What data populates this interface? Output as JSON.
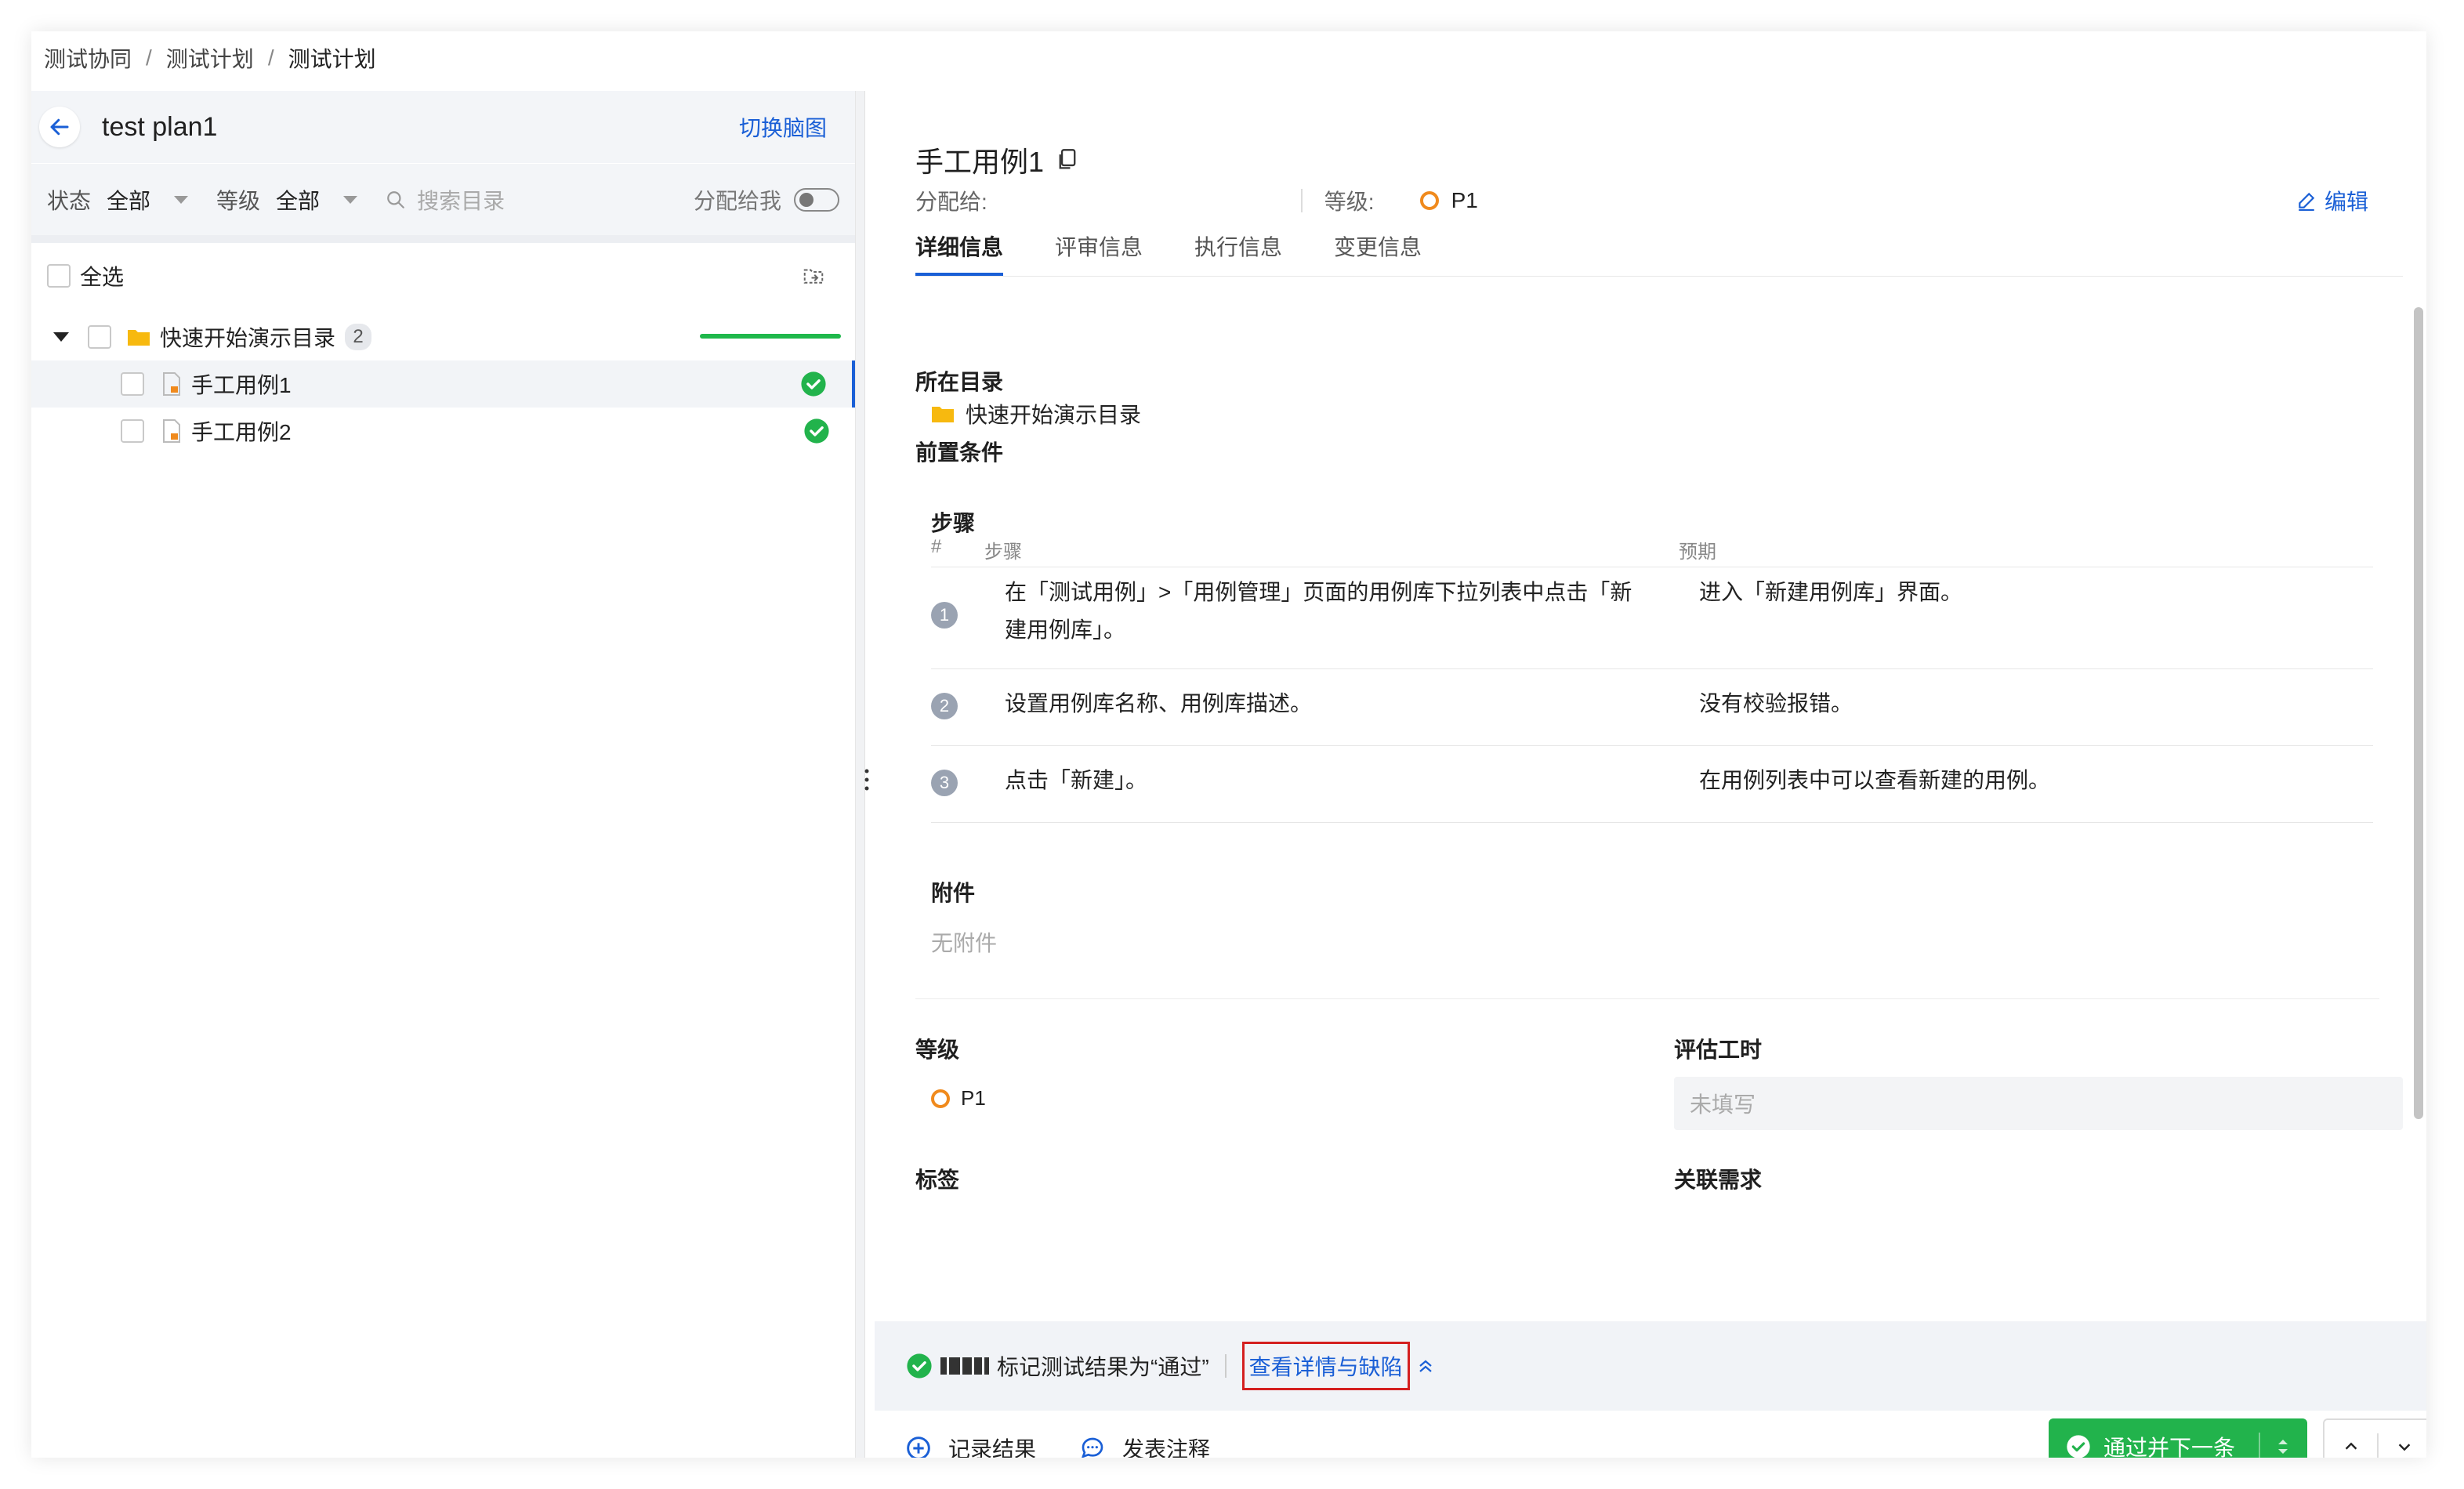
{
  "breadcrumb": [
    "测试协同",
    "测试计划",
    "测试计划"
  ],
  "left": {
    "plan_title": "test plan1",
    "switch_link": "切换脑图",
    "filters": {
      "status_label": "状态",
      "status_value": "全部",
      "level_label": "等级",
      "level_value": "全部",
      "search_placeholder": "搜索目录",
      "assign_label": "分配给我"
    },
    "select_all": "全选",
    "folder": {
      "name": "快速开始演示目录",
      "count": "2"
    },
    "cases": [
      {
        "name": "手工用例1",
        "status": "passed"
      },
      {
        "name": "手工用例2",
        "status": "passed"
      }
    ]
  },
  "detail": {
    "title": "手工用例1",
    "assignee_label": "分配给:",
    "level_label": "等级:",
    "level_value": "P1",
    "edit_label": "编辑",
    "tabs": [
      "详细信息",
      "评审信息",
      "执行信息",
      "变更信息"
    ],
    "directory_label": "所在目录",
    "directory_value": "快速开始演示目录",
    "precondition_label": "前置条件",
    "steps_label": "步骤",
    "steps_header": {
      "num": "#",
      "step": "步骤",
      "expected": "预期"
    },
    "steps": [
      {
        "num": "1",
        "step": "在「测试用例」>「用例管理」页面的用例库下拉列表中点击「新建用例库」。",
        "expected": "进入「新建用例库」界面。"
      },
      {
        "num": "2",
        "step": "设置用例库名称、用例库描述。",
        "expected": "没有校验报错。"
      },
      {
        "num": "3",
        "step": "点击「新建」。",
        "expected": "在用例列表中可以查看新建的用例。"
      }
    ],
    "attachment_label": "附件",
    "attachment_value": "无附件",
    "priority_label": "等级",
    "priority_value": "P1",
    "estimate_label": "评估工时",
    "estimate_value": "未填写",
    "tag_label": "标签",
    "requirement_label": "关联需求"
  },
  "notification": {
    "text": "标记测试结果为“通过”",
    "link": "查看详情与缺陷"
  },
  "footer": {
    "record_result": "记录结果",
    "comment": "发表注释",
    "pass_next": "通过并下一条"
  },
  "colors": {
    "accent": "#1a5fd6",
    "success": "#22b34c",
    "priority": "#f08a1d",
    "highlight_border": "#d41f1f"
  }
}
